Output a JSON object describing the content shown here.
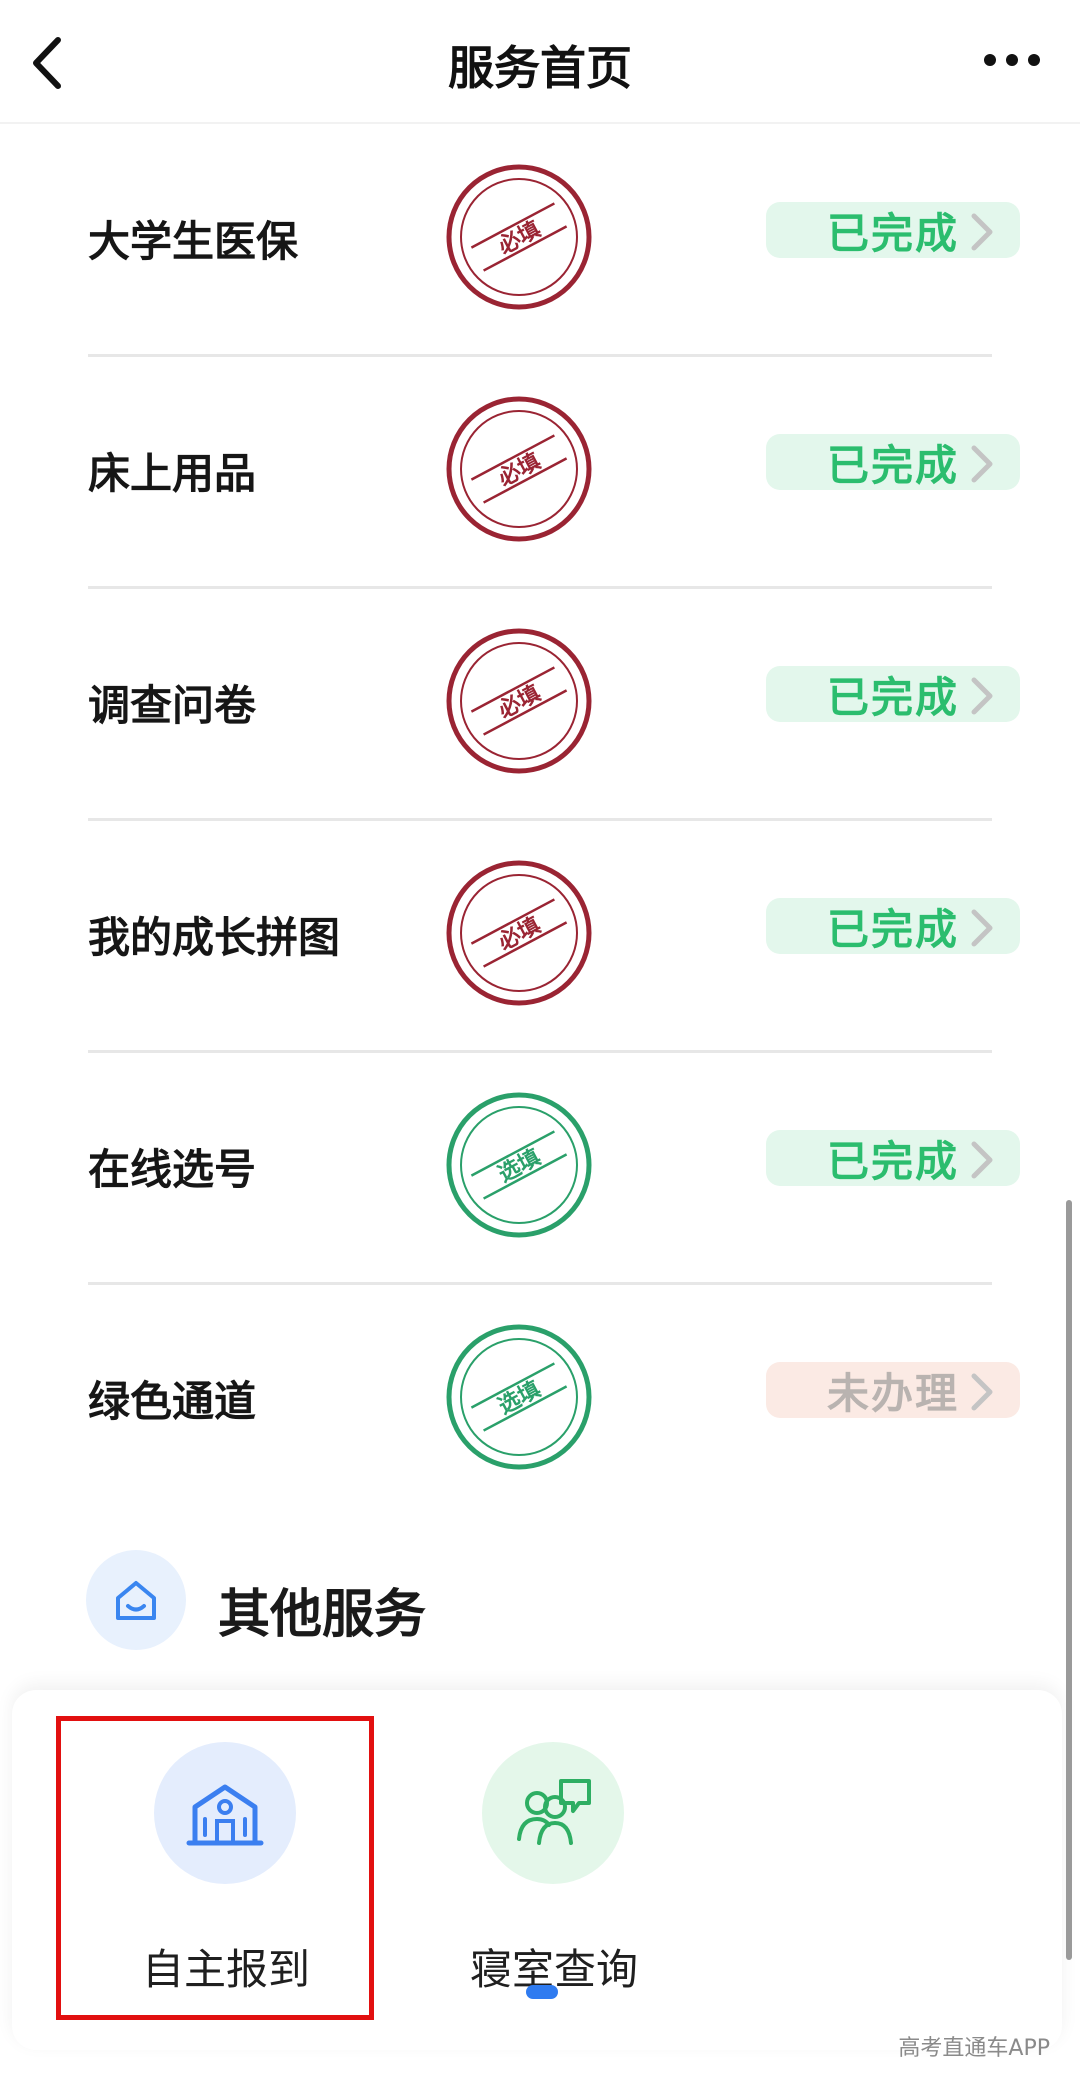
{
  "nav": {
    "title": "服务首页"
  },
  "services": [
    {
      "label": "大学生医保",
      "stamp": "必填",
      "status": "已完成"
    },
    {
      "label": "床上用品",
      "stamp": "必填",
      "status": "已完成"
    },
    {
      "label": "调查问卷",
      "stamp": "必填",
      "status": "已完成"
    },
    {
      "label": "我的成长拼图",
      "stamp": "必填",
      "status": "已完成"
    },
    {
      "label": "在线选号",
      "stamp": "选填",
      "status": "已完成"
    },
    {
      "label": "绿色通道",
      "stamp": "选填",
      "status": "未办理"
    }
  ],
  "other": {
    "title": "其他服务",
    "tiles": [
      {
        "label": "自主报到",
        "icon": "school-building-icon"
      },
      {
        "label": "寝室查询",
        "icon": "roommates-chat-icon"
      }
    ]
  },
  "watermark": "高考直通车APP",
  "colors": {
    "stamp_required": "#9a2433",
    "stamp_optional": "#2aa06a",
    "status_done_bg": "#e3f7ec",
    "status_done_text": "#2bbd6e",
    "status_todo_bg": "#fbeae4",
    "status_todo_text": "#b9b3b0",
    "highlight": "#e21010",
    "accent_blue": "#2f7bf0"
  }
}
